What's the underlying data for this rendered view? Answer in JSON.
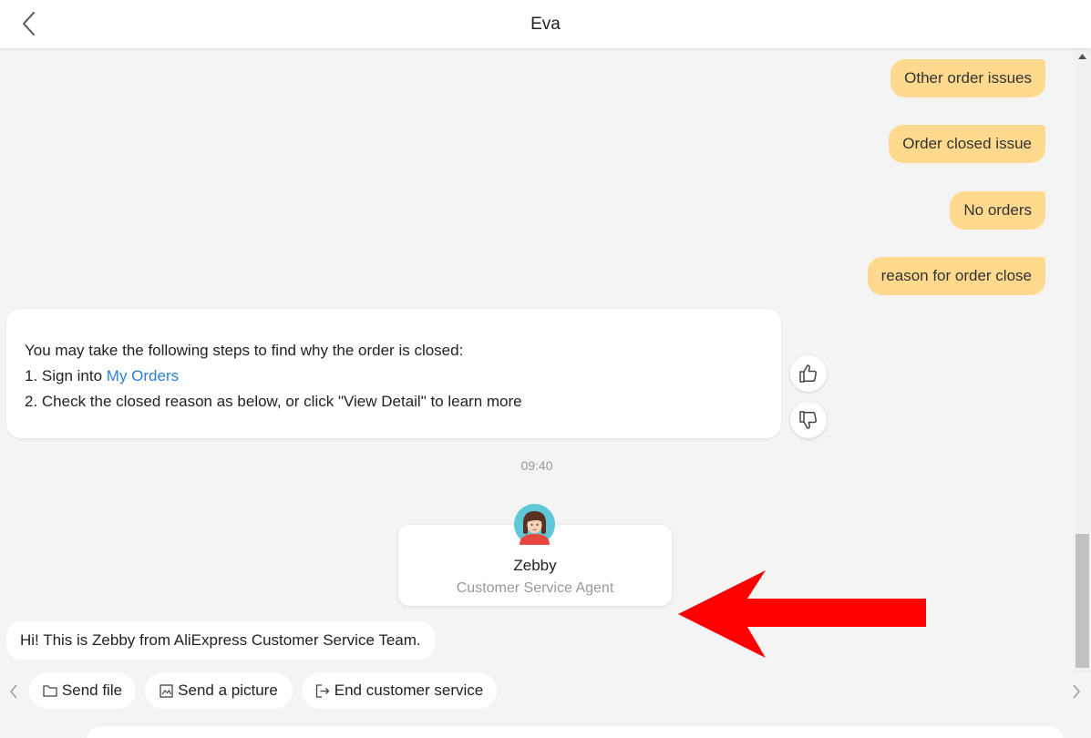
{
  "header": {
    "title": "Eva"
  },
  "user_messages": [
    "Other order issues",
    "Order closed issue",
    "No orders",
    "reason for order close"
  ],
  "bot_message": {
    "line1": "You may take the following steps to find why the order is closed:",
    "line2_prefix": "1. Sign into ",
    "line2_link": "My Orders",
    "line3": "2. Check the closed reason as below, or click \"View Detail\" to learn more"
  },
  "timestamp": "09:40",
  "agent": {
    "name": "Zebby",
    "role": "Customer Service Agent"
  },
  "greeting": "Hi! This is Zebby from AliExpress Customer Service Team.",
  "quick_actions": {
    "send_file": "Send file",
    "send_picture": "Send a picture",
    "end_service": "End customer service"
  },
  "icons": {
    "back": "chevron-left-icon",
    "thumbs_up": "thumbs-up-icon",
    "thumbs_down": "thumbs-down-icon",
    "folder": "folder-icon",
    "image": "image-icon",
    "exit": "exit-icon"
  },
  "colors": {
    "user_bubble": "#ffd98e",
    "link": "#2e7fd6",
    "annotation_arrow": "#ff0000",
    "background": "#f3f4f3"
  }
}
